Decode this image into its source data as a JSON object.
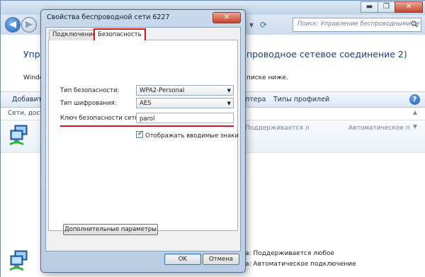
{
  "colors": {
    "accent_red": "#d21818",
    "heading_blue": "#1d3d7a",
    "titlebar": "#c3d5ea"
  },
  "background_window": {
    "window_buttons": {
      "minimize": "▬",
      "maximize": "❐",
      "close": "✕"
    },
    "nav": {
      "back_icon": "◀",
      "forward_icon": "▶",
      "dropdown_icon": "▼",
      "refresh_icon": "⟳"
    },
    "search_placeholder": "Поиск: Управление беспроводными сетями",
    "heading_left": "Управ",
    "heading_right": "проводное сетевое соединение 2)",
    "sub_left": "Window",
    "sub_right": "писке ниже.",
    "toolbar": {
      "add_label": "Добавить",
      "adapter_label": "птера",
      "profile_types_label": "Типы профилей",
      "help_icon": "?"
    },
    "list_header": "Сети, досту",
    "rows": [
      {
        "col1": "Поддерживается л",
        "col2": "Автоматическое п"
      },
      {
        "col1": "а: Поддерживается любое",
        "col2": "а: Автоматическое подключение"
      }
    ]
  },
  "dialog": {
    "title": "Свойства беспроводной сети 6227",
    "close_icon": "✕",
    "tabs": [
      {
        "label": "Подключение"
      },
      {
        "label": "Безопасность"
      }
    ],
    "security_type_label": "Тип безопасности:",
    "security_type_value": "WPA2-Personal",
    "encryption_type_label": "Тип шифрования:",
    "encryption_type_value": "AES",
    "network_key_label": "Ключ безопасности сети",
    "network_key_value": "parol",
    "show_chars_label": "Отображать вводимые знаки",
    "show_chars_checked": true,
    "advanced_button": "Дополнительные параметры",
    "ok_button": "OK",
    "cancel_button": "Отмена"
  }
}
